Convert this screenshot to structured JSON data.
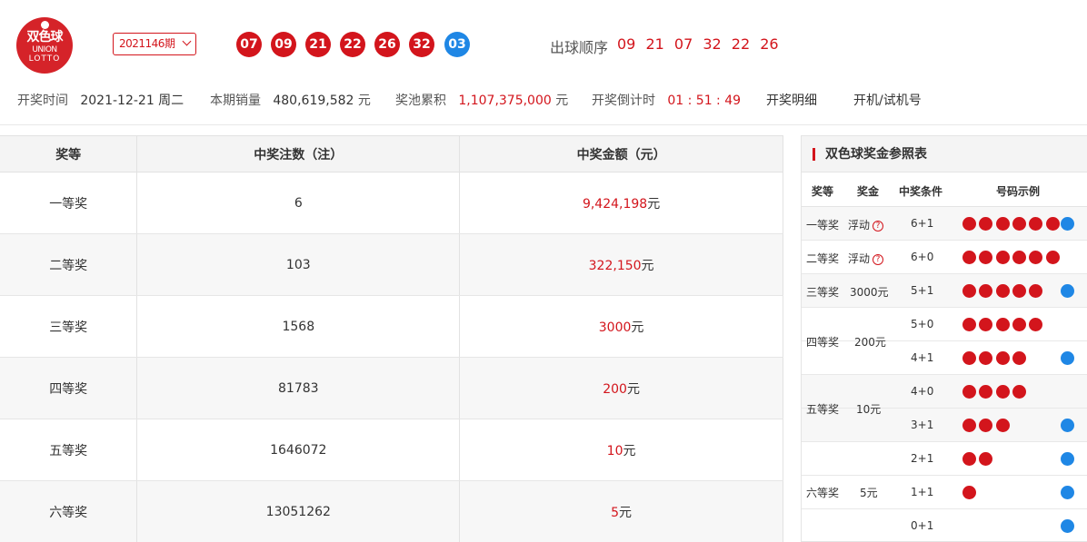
{
  "logo": {
    "line1": "双色球",
    "line2": "UNION",
    "line3": "LOTTO"
  },
  "period": {
    "label": "2021146期"
  },
  "draw": {
    "red_balls": [
      "07",
      "09",
      "21",
      "22",
      "26",
      "32"
    ],
    "blue_ball": "03",
    "order_label": "出球顺序",
    "order": "09 21 07 32 22 26"
  },
  "info": {
    "time_label": "开奖时间",
    "time_value": "2021-12-21 周二",
    "sales_label": "本期销量",
    "sales_value": "480,619,582",
    "sales_unit": "元",
    "pool_label": "奖池累积",
    "pool_value": "1,107,375,000",
    "pool_unit": "元",
    "countdown_label": "开奖倒计时",
    "countdown_value": "01 : 51 : 49",
    "detail_link": "开奖明细",
    "test_link": "开机/试机号"
  },
  "main_table": {
    "headers": [
      "奖等",
      "中奖注数（注）",
      "中奖金额（元）"
    ],
    "rows": [
      {
        "level": "一等奖",
        "count": "6",
        "amount": "9,424,198",
        "unit": "元"
      },
      {
        "level": "二等奖",
        "count": "103",
        "amount": "322,150",
        "unit": "元"
      },
      {
        "level": "三等奖",
        "count": "1568",
        "amount": "3000",
        "unit": "元"
      },
      {
        "level": "四等奖",
        "count": "81783",
        "amount": "200",
        "unit": "元"
      },
      {
        "level": "五等奖",
        "count": "1646072",
        "amount": "10",
        "unit": "元"
      },
      {
        "level": "六等奖",
        "count": "13051262",
        "amount": "5",
        "unit": "元"
      }
    ]
  },
  "side_table": {
    "title": "双色球奖金参照表",
    "headers": [
      "奖等",
      "奖金",
      "中奖条件",
      "号码示例"
    ],
    "prizes": [
      {
        "level": "一等奖",
        "money": "浮动",
        "help": "?"
      },
      {
        "level": "二等奖",
        "money": "浮动",
        "help": "?"
      },
      {
        "level": "三等奖",
        "money": "3000元"
      },
      {
        "level": "四等奖",
        "money": "200元"
      },
      {
        "level": "五等奖",
        "money": "10元"
      },
      {
        "level": "六等奖",
        "money": "5元"
      }
    ],
    "rows": [
      {
        "cond": "6+1",
        "reds": 6,
        "blue": 1
      },
      {
        "cond": "6+0",
        "reds": 6,
        "blue": 0
      },
      {
        "cond": "5+1",
        "reds": 5,
        "blue": 1
      },
      {
        "cond": "5+0",
        "reds": 5,
        "blue": 0
      },
      {
        "cond": "4+1",
        "reds": 4,
        "blue": 1
      },
      {
        "cond": "4+0",
        "reds": 4,
        "blue": 0
      },
      {
        "cond": "3+1",
        "reds": 3,
        "blue": 1
      },
      {
        "cond": "2+1",
        "reds": 2,
        "blue": 1
      },
      {
        "cond": "1+1",
        "reds": 1,
        "blue": 1
      },
      {
        "cond": "0+1",
        "reds": 0,
        "blue": 1
      }
    ]
  },
  "colors": {
    "red": "#d3151c",
    "blue": "#1f87e5"
  }
}
